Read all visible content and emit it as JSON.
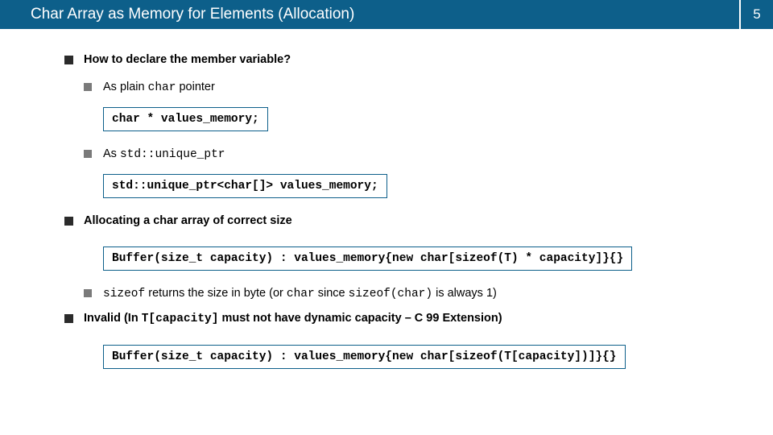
{
  "header": {
    "title": "Char Array as Memory for Elements (Allocation)",
    "slide_number": "5"
  },
  "body": {
    "q1": "How to declare the member variable?",
    "q1_a_pre": "As plain ",
    "q1_a_code": "char",
    "q1_a_post": " pointer",
    "code1": "char * values_memory;",
    "q1_b_pre": "As ",
    "q1_b_code": "std::unique_ptr",
    "code2": "std::unique_ptr<char[]> values_memory;",
    "q2": "Allocating a char array of correct size",
    "code3": "Buffer(size_t capacity) : values_memory{new char[sizeof(T) * capacity]}{}",
    "q2_a_code1": "sizeof",
    "q2_a_mid": " returns the size in byte (or ",
    "q2_a_code2": "char",
    "q2_a_mid2": " since ",
    "q2_a_code3": "sizeof(char)",
    "q2_a_post": " is always 1)",
    "q3_pre": "Invalid (In ",
    "q3_code": "T[capacity]",
    "q3_post": " must not have dynamic capacity – C 99 Extension)",
    "code4": "Buffer(size_t capacity) : values_memory{new char[sizeof(T[capacity])]}{}"
  }
}
